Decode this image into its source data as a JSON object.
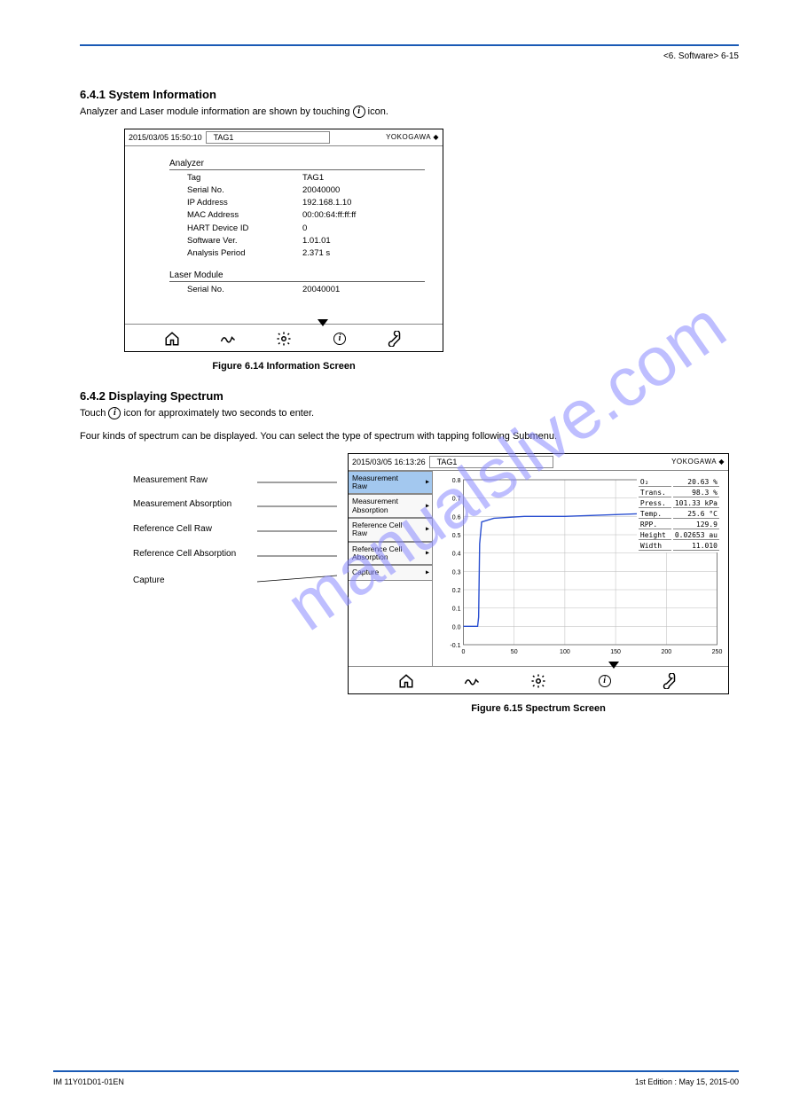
{
  "header": {
    "right": "<6. Software>      6-15"
  },
  "section1": {
    "heading": "6.4.1   System Information",
    "para_a": "Analyzer and Laser module information are shown by touching ",
    "para_b": " icon."
  },
  "screenshot1": {
    "datetime": "2015/03/05 15:50:10",
    "tag": "TAG1",
    "brand": "YOKOGAWA ◆",
    "group1_title": "Analyzer",
    "rows1": [
      {
        "k": "Tag",
        "v": "TAG1"
      },
      {
        "k": "Serial No.",
        "v": "20040000"
      },
      {
        "k": "IP Address",
        "v": "192.168.1.10"
      },
      {
        "k": "MAC Address",
        "v": "00:00:64:ff:ff:ff"
      },
      {
        "k": "HART Device ID",
        "v": "0"
      },
      {
        "k": "Software Ver.",
        "v": "1.01.01"
      },
      {
        "k": "Analysis Period",
        "v": "2.371 s"
      }
    ],
    "group2_title": "Laser Module",
    "rows2": [
      {
        "k": "Serial No.",
        "v": "20040001"
      }
    ]
  },
  "fig1_caption": "Figure 6.14   Information Screen",
  "section2": {
    "heading": "6.4.2   Displaying Spectrum",
    "instruction_a": "Touch ",
    "instruction_b": " icon for approximately two seconds to enter.",
    "description": "Four kinds of spectrum can be displayed. You can select the type of spectrum with tapping following Submenu."
  },
  "callouts": {
    "c1": "Measurement Raw",
    "c2": "Measurement Absorption",
    "c3": "Reference Cell Raw",
    "c4": "Reference Cell Absorption",
    "c5": "Capture"
  },
  "screenshot2": {
    "datetime": "2015/03/05 16:13:26",
    "tag": "TAG1",
    "brand": "YOKOGAWA ◆",
    "menu": [
      {
        "label": "Measurement\nRaw",
        "selected": true
      },
      {
        "label": "Measurement\nAbsorption",
        "selected": false
      },
      {
        "label": "Reference Cell\nRaw",
        "selected": false
      },
      {
        "label": "Reference Cell\nAbsorption",
        "selected": false
      },
      {
        "label": "Capture",
        "selected": false
      }
    ],
    "readouts": [
      {
        "k": "O₂",
        "v": "20.63 %"
      },
      {
        "k": "Trans.",
        "v": "98.3 %"
      },
      {
        "k": "Press.",
        "v": "101.33 kPa"
      },
      {
        "k": "Temp.",
        "v": "25.6 °C"
      },
      {
        "k": "RPP.",
        "v": "129.9"
      },
      {
        "k": "Height",
        "v": "0.02653 au"
      },
      {
        "k": "Width",
        "v": "11.010"
      }
    ]
  },
  "chart_data": {
    "type": "line",
    "title": "",
    "xlabel": "",
    "ylabel": "",
    "xlim": [
      0,
      250
    ],
    "ylim": [
      -0.1,
      0.8
    ],
    "x_ticks": [
      0,
      50,
      100,
      150,
      200,
      250
    ],
    "y_ticks": [
      -0.1,
      0.0,
      0.1,
      0.2,
      0.3,
      0.4,
      0.5,
      0.6,
      0.7,
      0.8
    ],
    "series": [
      {
        "name": "Measurement Raw",
        "color": "#2a4fd0",
        "x": [
          0,
          10,
          12,
          14,
          15,
          16,
          18,
          30,
          60,
          100,
          150,
          200,
          250
        ],
        "values": [
          0.0,
          0.0,
          0.0,
          0.0,
          0.05,
          0.45,
          0.57,
          0.59,
          0.6,
          0.6,
          0.61,
          0.62,
          0.62
        ]
      }
    ]
  },
  "fig2_caption": "Figure 6.15   Spectrum Screen",
  "footer": {
    "left": "IM 11Y01D01-01EN",
    "right": "1st Edition : May 15, 2015-00"
  },
  "watermark": "manualslive.com"
}
